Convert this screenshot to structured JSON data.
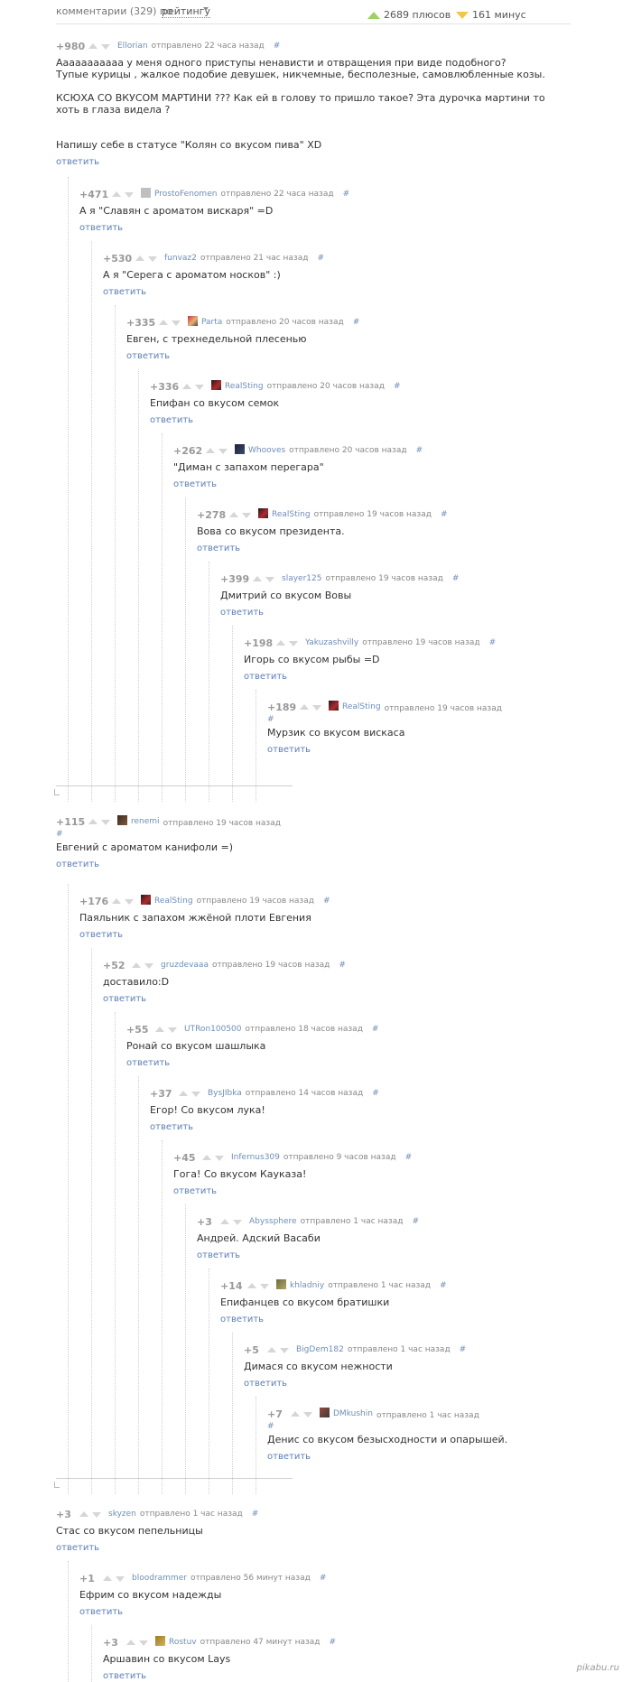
{
  "header": {
    "comments_label": "комментарии (329) по",
    "sort_label": "рейтингу",
    "pluses_label": "2689 плюсов",
    "minuses_label": "161 минус"
  },
  "comments": [
    {
      "rating": "+980",
      "author": "Ellorian",
      "time": "отправлено 22 часа назад",
      "hash": "#",
      "avatar": "none",
      "text": "Ааааааааааа у меня одного приступы ненависти и отвращения при виде подобного?\nТупые курицы , жалкое подобие девушек, никчемные, бесполезные, самовлюбленные козы.\n\nКСЮХА СО ВКУСОМ МАРТИНИ ??? Как ей в голову то пришло такое? Эта дурочка мартини то хоть в глаза видела ?\n\n\nНапишу себе в статусе \"Колян со вкусом пива\" XD",
      "reply": "ответить"
    },
    {
      "rating": "+471",
      "author": "ProstoFenomen",
      "time": "отправлено 22 часа назад",
      "hash": "#",
      "avatar": "gray",
      "text": "А я \"Славян с ароматом вискаря\" =D",
      "reply": "ответить"
    },
    {
      "rating": "+530",
      "author": "funvaz2",
      "time": "отправлено 21 час назад",
      "hash": "#",
      "avatar": "none",
      "text": "А я \"Серега с ароматом носков\" :)",
      "reply": "ответить"
    },
    {
      "rating": "+335",
      "author": "Parta",
      "time": "отправлено 20 часов назад",
      "hash": "#",
      "avatar": "doll",
      "text": "Евген, с трехнедельной плесенью",
      "reply": "ответить"
    },
    {
      "rating": "+336",
      "author": "RealSting",
      "time": "отправлено 20 часов назад",
      "hash": "#",
      "avatar": "red",
      "text": "Епифан со вкусом семок",
      "reply": "ответить"
    },
    {
      "rating": "+262",
      "author": "Whooves",
      "time": "отправлено 20 часов назад",
      "hash": "#",
      "avatar": "dark",
      "text": "\"Диман с запахом перегара\"",
      "reply": "ответить"
    },
    {
      "rating": "+278",
      "author": "RealSting",
      "time": "отправлено 19 часов назад",
      "hash": "#",
      "avatar": "red",
      "text": "Вова со вкусом президента.",
      "reply": "ответить"
    },
    {
      "rating": "+399",
      "author": "slayer125",
      "time": "отправлено 19 часов назад",
      "hash": "#",
      "avatar": "none",
      "text": "Дмитрий со вкусом Вовы",
      "reply": "ответить"
    },
    {
      "rating": "+198",
      "author": "Yakuzashvilly",
      "time": "отправлено 19 часов назад",
      "hash": "#",
      "avatar": "none",
      "text": "Игорь со вкусом рыбы =D",
      "reply": "ответить"
    },
    {
      "rating": "+189",
      "author": "RealSting",
      "time": "отправлено 19 часов назад",
      "hash": "#",
      "avatar": "red",
      "text": "Мурзик со вкусом вискаса",
      "reply": "ответить"
    },
    {
      "rating": "+115",
      "author": "renemi",
      "time": "отправлено 19 часов назад",
      "hash": "#",
      "avatar": "brown",
      "text": "Евгений с ароматом канифоли =)",
      "reply": "ответить"
    },
    {
      "rating": "+176",
      "author": "RealSting",
      "time": "отправлено 19 часов назад",
      "hash": "#",
      "avatar": "red",
      "text": "Паяльник с запахом жжёной плоти Евгения",
      "reply": "ответить"
    },
    {
      "rating": "+52",
      "author": "gruzdevaaa",
      "time": "отправлено 19 часов назад",
      "hash": "#",
      "avatar": "none",
      "text": "доставило:D",
      "reply": "ответить"
    },
    {
      "rating": "+55",
      "author": "UTRon100500",
      "time": "отправлено 18 часов назад",
      "hash": "#",
      "avatar": "none",
      "text": "Ронай со вкусом шашлыка",
      "reply": "ответить"
    },
    {
      "rating": "+37",
      "author": "BysJIbka",
      "time": "отправлено 14 часов назад",
      "hash": "#",
      "avatar": "none",
      "text": "Егор! Со вкусом лука!",
      "reply": "ответить"
    },
    {
      "rating": "+45",
      "author": "Infernus309",
      "time": "отправлено 9 часов назад",
      "hash": "#",
      "avatar": "none",
      "text": "Гога! Со вкусом Кауказа!",
      "reply": "ответить"
    },
    {
      "rating": "+3",
      "author": "Abyssphere",
      "time": "отправлено 1 час назад",
      "hash": "#",
      "avatar": "none",
      "text": "Андрей. Адский Васаби",
      "reply": "ответить"
    },
    {
      "rating": "+14",
      "author": "khladniy",
      "time": "отправлено 1 час назад",
      "hash": "#",
      "avatar": "olive",
      "text": "Епифанцев со вкусом братишки",
      "reply": "ответить"
    },
    {
      "rating": "+5",
      "author": "BigDem182",
      "time": "отправлено 1 час назад",
      "hash": "#",
      "avatar": "none",
      "text": "Димася со вкусом нежности",
      "reply": "ответить"
    },
    {
      "rating": "+7",
      "author": "DMkushin",
      "time": "отправлено 1 час назад",
      "hash": "#",
      "avatar": "face",
      "text": "Денис со вкусом безысходности и опарышей.",
      "reply": "ответить"
    },
    {
      "rating": "+3",
      "author": "skyzen",
      "time": "отправлено 1 час назад",
      "hash": "#",
      "avatar": "none",
      "text": "Стас со вкусом пепельницы",
      "reply": "ответить"
    },
    {
      "rating": "+1",
      "author": "bloodrammer",
      "time": "отправлено 56 минут назад",
      "hash": "#",
      "avatar": "none",
      "text": "Ефрим со вкусом надежды",
      "reply": "ответить"
    },
    {
      "rating": "+3",
      "author": "Rostuv",
      "time": "отправлено 47 минут назад",
      "hash": "#",
      "avatar": "gold",
      "text": "Аршавин со вкусом Lays",
      "reply": "ответить"
    }
  ],
  "watermark": "pikabu.ru",
  "colors": {
    "plus": "#9fd066",
    "minus": "#f2c648",
    "link": "#5b7fb5",
    "author": "#6e8eb8"
  }
}
